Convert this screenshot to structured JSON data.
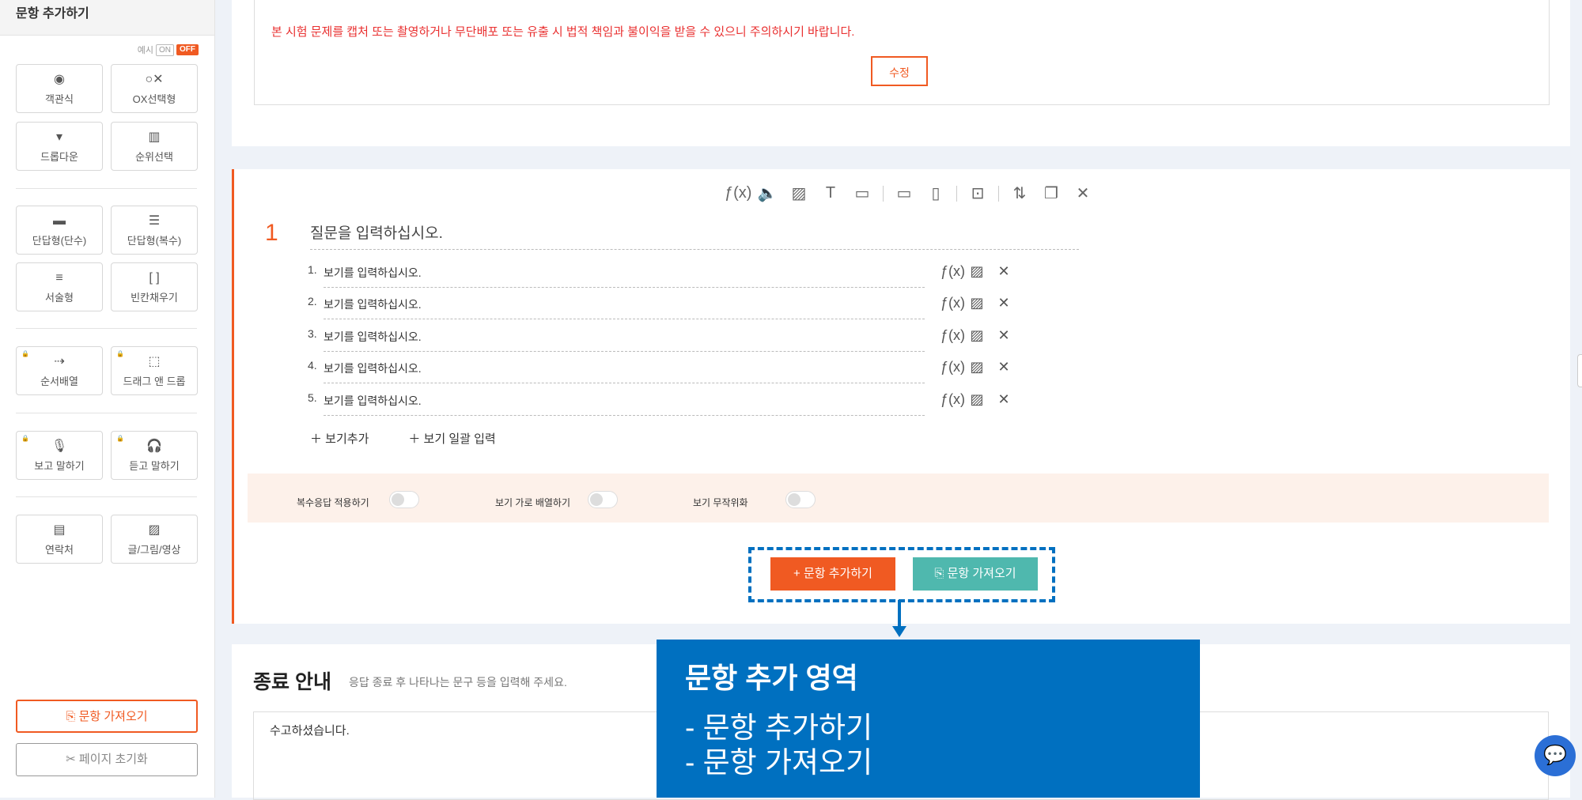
{
  "sidebar": {
    "title": "문항 추가하기",
    "example_label": "예시",
    "toggle_on": "ON",
    "toggle_off": "OFF",
    "tiles": [
      {
        "label": "객관식",
        "icon": "radio-icon",
        "glyph": "◉"
      },
      {
        "label": "OX선택형",
        "icon": "ox-icon",
        "glyph": "○✕"
      },
      {
        "label": "드롭다운",
        "icon": "dropdown-icon",
        "glyph": "▾"
      },
      {
        "label": "순위선택",
        "icon": "ranking-icon",
        "glyph": "▥"
      },
      {
        "label": "단답형(단수)",
        "icon": "short-answer-icon",
        "glyph": "▬"
      },
      {
        "label": "단답형(복수)",
        "icon": "short-answer-multi-icon",
        "glyph": "☰"
      },
      {
        "label": "서술형",
        "icon": "essay-icon",
        "glyph": "≡"
      },
      {
        "label": "빈칸채우기",
        "icon": "blank-icon",
        "glyph": "[ ]"
      },
      {
        "label": "순서배열",
        "icon": "sequence-icon",
        "glyph": "⇢"
      },
      {
        "label": "드래그 앤 드롭",
        "icon": "drag-drop-icon",
        "glyph": "⬚"
      },
      {
        "label": "보고 말하기",
        "icon": "mic-icon",
        "glyph": "🎙"
      },
      {
        "label": "듣고 말하기",
        "icon": "headset-mic-icon",
        "glyph": "🎧"
      },
      {
        "label": "연락처",
        "icon": "contact-icon",
        "glyph": "▤"
      },
      {
        "label": "글/그림/영상",
        "icon": "media-icon",
        "glyph": "▨"
      }
    ],
    "import_button": "문항 가져오기",
    "reset_button": "페이지 초기화"
  },
  "warning": {
    "text": "본 시험 문제를 캡처 또는 촬영하거나 무단배포 또는 유출 시 법적 책임과 불이익을 받을 수 있으니 주의하시기 바랍니다.",
    "edit_button": "수정"
  },
  "question": {
    "number": "1",
    "placeholder": "질문을 입력하십시오.",
    "options": [
      {
        "num": "1.",
        "text": "보기를 입력하십시오."
      },
      {
        "num": "2.",
        "text": "보기를 입력하십시오."
      },
      {
        "num": "3.",
        "text": "보기를 입력하십시오."
      },
      {
        "num": "4.",
        "text": "보기를 입력하십시오."
      },
      {
        "num": "5.",
        "text": "보기를 입력하십시오."
      }
    ],
    "add_option": "보기추가",
    "bulk_option": "보기 일괄 입력",
    "toggles": [
      "복수응답 적용하기",
      "보기 가로 배열하기",
      "보기 무작위화"
    ],
    "add_question_button": "+ 문항 추가하기",
    "import_question_button": "문항 가져오기"
  },
  "end": {
    "title": "종료 안내",
    "subtitle": "응답 종료 후 나타나는 문구 등을 입력해 주세요.",
    "text": "수고하셨습니다."
  },
  "callout": {
    "title": "문항 추가 영역",
    "items": [
      "-   문항 추가하기",
      "-   문항 가져오기"
    ]
  }
}
